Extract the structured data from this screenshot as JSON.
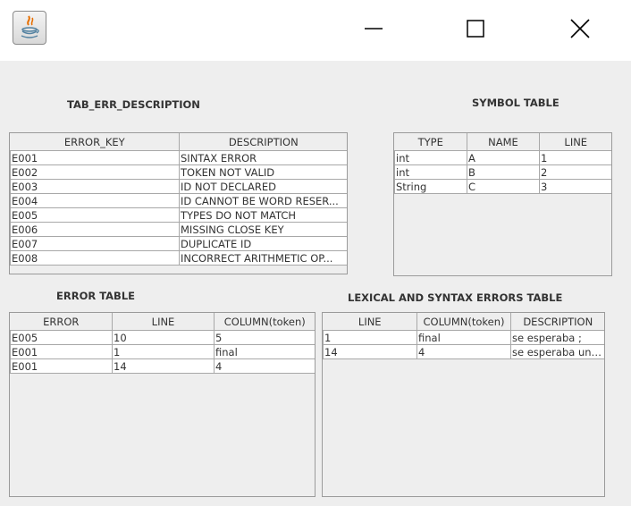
{
  "window": {
    "icon": "java-icon",
    "controls": [
      "minimize-icon",
      "maximize-icon",
      "close-icon"
    ]
  },
  "err_desc_table": {
    "title": "TAB_ERR_DESCRIPTION",
    "headers": [
      "ERROR_KEY",
      "DESCRIPTION"
    ],
    "rows": [
      [
        "E001",
        "SINTAX ERROR"
      ],
      [
        "E002",
        "TOKEN NOT VALID"
      ],
      [
        "E003",
        "ID NOT DECLARED"
      ],
      [
        "E004",
        "ID CANNOT BE WORD RESER..."
      ],
      [
        "E005",
        "TYPES DO NOT MATCH"
      ],
      [
        "E006",
        "MISSING CLOSE KEY"
      ],
      [
        "E007",
        "DUPLICATE ID"
      ],
      [
        "E008",
        " INCORRECT ARITHMETIC OP..."
      ]
    ]
  },
  "symbol_table": {
    "title": "SYMBOL TABLE",
    "headers": [
      "TYPE",
      "NAME",
      "LINE"
    ],
    "rows": [
      [
        "int",
        "A",
        "1"
      ],
      [
        "int",
        "B",
        "2"
      ],
      [
        "String",
        "C",
        "3"
      ]
    ]
  },
  "error_table": {
    "title": "ERROR TABLE",
    "headers": [
      "ERROR",
      "LINE",
      "COLUMN(token)"
    ],
    "rows": [
      [
        "E005",
        "10",
        "5"
      ],
      [
        "E001",
        "1",
        "final"
      ],
      [
        "E001",
        "14",
        "4"
      ]
    ]
  },
  "lex_syntax_table": {
    "title": "LEXICAL AND SYNTAX ERRORS TABLE",
    "headers": [
      "LINE",
      "COLUMN(token)",
      "DESCRIPTION"
    ],
    "rows": [
      [
        "1",
        "final",
        "se esperaba ;"
      ],
      [
        "14",
        "4",
        "se esperaba un ..."
      ]
    ]
  }
}
